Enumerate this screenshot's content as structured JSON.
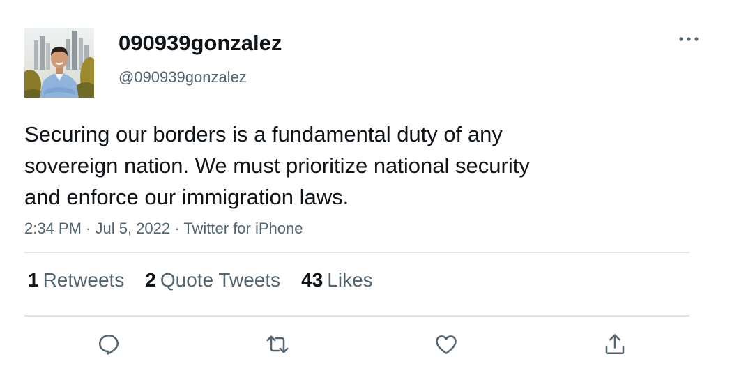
{
  "tweet": {
    "author": {
      "display_name": "090939gonzalez",
      "username": "@090939gonzalez"
    },
    "text": "Securing our borders is a fundamental duty of any\nsovereign nation. We must prioritize national security\nand enforce our immigration laws.",
    "time": "2:34 PM",
    "date": "Jul 5, 2022",
    "source": "Twitter for iPhone",
    "separator": " · ",
    "stats": [
      {
        "count": "1",
        "label": "Retweets"
      },
      {
        "count": "2",
        "label": "Quote Tweets"
      },
      {
        "count": "43",
        "label": "Likes"
      }
    ]
  },
  "icons": {
    "more": "more-horizontal-icon",
    "reply": "reply-icon",
    "retweet": "retweet-icon",
    "like": "heart-icon",
    "share": "share-icon"
  },
  "colors": {
    "text_primary": "#0f1419",
    "text_secondary": "#536471",
    "icon": "#536471",
    "divider": "#dfe3e6"
  }
}
